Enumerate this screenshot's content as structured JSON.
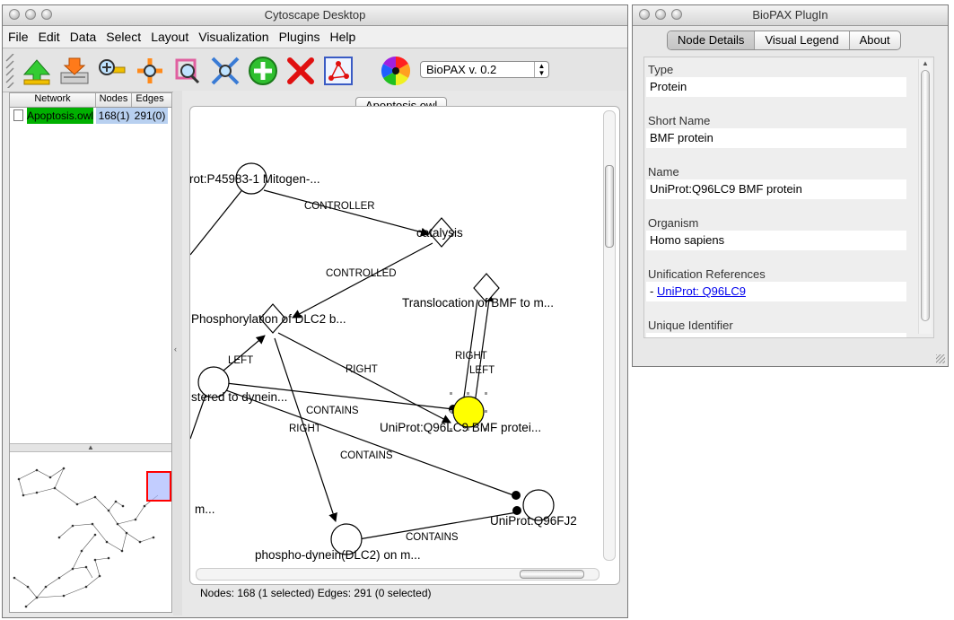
{
  "main_window": {
    "title": "Cytoscape Desktop",
    "menu": [
      "File",
      "Edit",
      "Data",
      "Select",
      "Layout",
      "Visualization",
      "Plugins",
      "Help"
    ],
    "toolbar_icons": [
      "open-network-icon",
      "import-icon",
      "zoom-in-icon",
      "zoom-out-icon",
      "zoom-selected-icon",
      "zoom-fit-icon",
      "add-icon",
      "delete-icon",
      "new-network-from-selection-icon",
      "vizmapper-icon"
    ],
    "layout_select": "BioPAX v. 0.2"
  },
  "network_table": {
    "headers": [
      "Network",
      "Nodes",
      "Edges"
    ],
    "rows": [
      {
        "name": "Apoptosis.owl",
        "nodes": "168(1)",
        "edges": "291(0)"
      }
    ]
  },
  "network_view": {
    "tab_label": "Apoptosis.owl",
    "status": "Nodes: 168 (1 selected) Edges: 291 (0 selected)",
    "node_labels": {
      "p45983": "rot:P45983-1 Mitogen-...",
      "catalysis": "catalysis",
      "phosphorylation": "Phosphorylation of DLC2 b...",
      "translocation": "Translocation of BMF to m...",
      "tethered": "stered to dynein...",
      "bmf": "UniProt:Q96LC9 BMF protei...",
      "q96fj2": "UniProt:Q96FJ2",
      "m": "m...",
      "phospho_dynein": "phospho-dynein(DLC2) on m..."
    },
    "edge_labels": {
      "controller": "CONTROLLER",
      "controlled": "CONTROLLED",
      "left1": "LEFT",
      "right1": "RIGHT",
      "right2": "RIGHT",
      "left2": "LEFT",
      "contains1": "CONTAINS",
      "right3": "RIGHT",
      "contains2": "CONTAINS",
      "contains3": "CONTAINS"
    }
  },
  "biopax_window": {
    "title": "BioPAX PlugIn",
    "tabs": [
      "Node Details",
      "Visual Legend",
      "About"
    ],
    "active_tab": "Node Details",
    "fields": [
      {
        "label": "Type",
        "value": "Protein"
      },
      {
        "label": "Short Name",
        "value": "BMF protein"
      },
      {
        "label": "Name",
        "value": "UniProt:Q96LC9 BMF protein"
      },
      {
        "label": "Organism",
        "value": "Homo sapiens"
      },
      {
        "label": "Unification References",
        "prefix": "- ",
        "link": "UniProt: Q96LC9"
      },
      {
        "label": "Unique Identifier",
        "value": ""
      }
    ]
  },
  "colors": {
    "selected_node": "#ffff00",
    "network_row_highlight": "#00b000",
    "cell_highlight": "#b8d0f0",
    "minimap_frame": "#ff0000",
    "link": "#0000ee"
  }
}
